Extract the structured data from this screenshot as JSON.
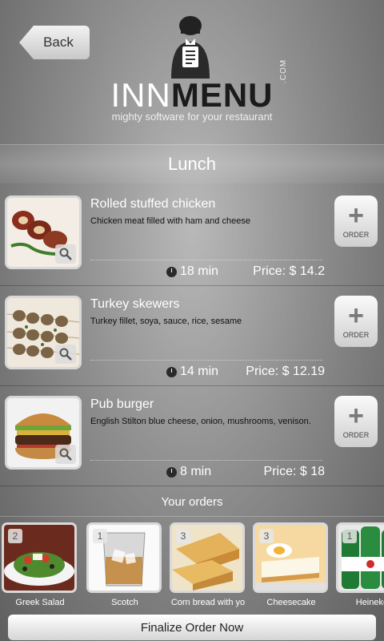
{
  "header": {
    "back_label": "Back",
    "brand_part1": "INN",
    "brand_part2": "MENU",
    "brand_suffix": ".COM",
    "tagline": "mighty software for your restaurant"
  },
  "section": {
    "title": "Lunch"
  },
  "menu": {
    "items": [
      {
        "name": "Rolled stuffed chicken",
        "description": "Chicken meat filled with ham and cheese",
        "time": "18 min",
        "price": "Price: $ 14.2",
        "order_label": "ORDER"
      },
      {
        "name": "Turkey skewers",
        "description": "Turkey fillet, soya, sauce, rice, sesame",
        "time": "14 min",
        "price": "Price: $ 12.19",
        "order_label": "ORDER"
      },
      {
        "name": "Pub burger",
        "description": "English Stilton blue cheese, onion, mushrooms, venison.",
        "time": "8 min",
        "price": "Price: $ 18",
        "order_label": "ORDER"
      }
    ]
  },
  "orders": {
    "title": "Your orders",
    "items": [
      {
        "qty": "2",
        "name": "Greek Salad"
      },
      {
        "qty": "1",
        "name": "Scotch"
      },
      {
        "qty": "3",
        "name": "Corn bread with yo"
      },
      {
        "qty": "3",
        "name": "Cheesecake"
      },
      {
        "qty": "1",
        "name": "Heineken"
      }
    ]
  },
  "footer": {
    "finalize_label": "Finalize Order Now"
  },
  "icons": [
    "chef-logo-icon",
    "clock-icon",
    "zoom-icon",
    "plus-icon"
  ]
}
